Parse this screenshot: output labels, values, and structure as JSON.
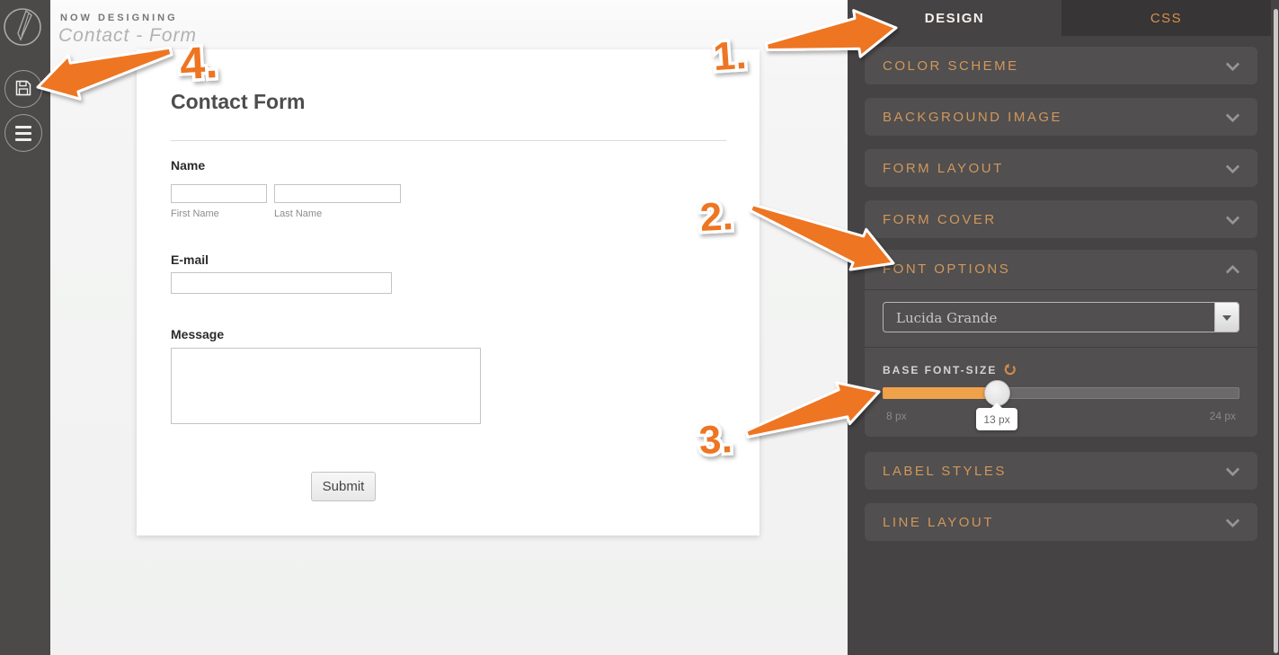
{
  "app": {
    "now_designing_label": "NOW DESIGNING",
    "form_name": "Contact - Form"
  },
  "sidebar": {
    "logo_icon": "pencil-logo",
    "save_icon": "save",
    "menu_icon": "menu"
  },
  "panel": {
    "tabs": {
      "design": "DESIGN",
      "css": "CSS"
    },
    "sections": [
      {
        "label": "COLOR SCHEME"
      },
      {
        "label": "BACKGROUND IMAGE"
      },
      {
        "label": "FORM LAYOUT"
      },
      {
        "label": "FORM COVER"
      },
      {
        "label": "LABEL STYLES"
      },
      {
        "label": "LINE LAYOUT"
      }
    ],
    "font_options": {
      "title": "FONT OPTIONS",
      "font_family_value": "Lucida Grande",
      "base_font_size_label": "BASE FONT-SIZE",
      "reset_icon": "undo-reset",
      "slider": {
        "min_label": "8 px",
        "value_label": "13 px",
        "max_label": "24 px",
        "percent": 32
      }
    }
  },
  "form": {
    "title": "Contact Form",
    "name_label": "Name",
    "first_name_sublabel": "First Name",
    "last_name_sublabel": "Last Name",
    "email_label": "E-mail",
    "message_label": "Message",
    "submit_label": "Submit"
  },
  "annotations": {
    "steps": [
      "1.",
      "2.",
      "3.",
      "4."
    ]
  },
  "colors": {
    "accent_orange": "#ee7421",
    "panel_bg": "#454343",
    "section_bg": "#514f4f",
    "section_text": "#d0975c",
    "slider_fill": "#f0a24b",
    "sidebar_bg": "#4c4a49"
  }
}
